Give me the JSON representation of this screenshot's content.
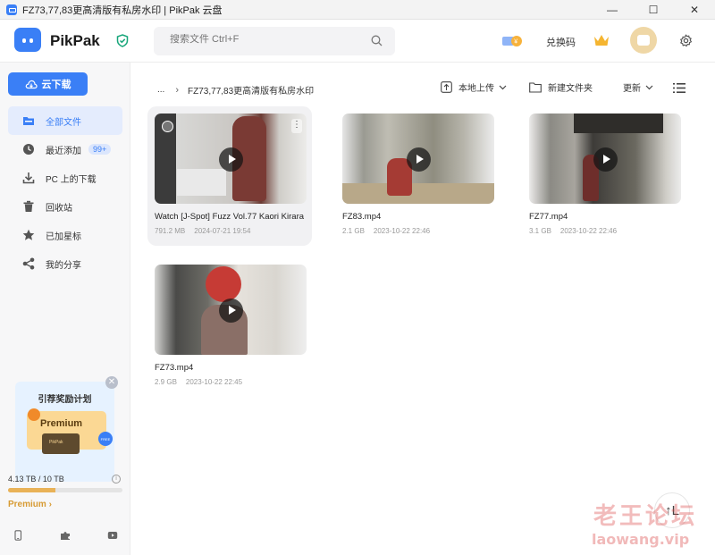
{
  "window": {
    "title": "FZ73,77,83更高清版有私房水印 | PikPak 云盘",
    "controls": [
      "—",
      "☐",
      "✕"
    ]
  },
  "header": {
    "brand": "PikPak",
    "search_placeholder": "搜索文件 Ctrl+F",
    "redeem_label": "兑换码"
  },
  "sidebar": {
    "cloud_download_label": "云下载",
    "items": [
      {
        "label": "全部文件",
        "icon": "folder-icon",
        "active": true
      },
      {
        "label": "最近添加",
        "icon": "clock-icon",
        "badge": "99+"
      },
      {
        "label": "PC 上的下载",
        "icon": "download-icon"
      },
      {
        "label": "回收站",
        "icon": "trash-icon"
      },
      {
        "label": "已加星标",
        "icon": "star-icon"
      },
      {
        "label": "我的分享",
        "icon": "share-icon"
      }
    ],
    "promo": {
      "title": "引荐奖励计划",
      "premium_text": "Premium",
      "free_tag": "FREE"
    },
    "storage": {
      "text": "4.13 TB / 10 TB",
      "used_fraction": 0.413
    },
    "premium_link": "Premium ›"
  },
  "toolbar": {
    "breadcrumb_root": "...",
    "breadcrumb_sep": "›",
    "breadcrumb_current": "FZ73,77,83更高清版有私房水印",
    "upload_label": "本地上传",
    "new_folder_label": "新建文件夹",
    "more_label": "更新"
  },
  "files": [
    {
      "name": "Watch [J-Spot] Fuzz Vol.77 Kaori Kirara",
      "size": "791.2 MB",
      "date": "2024-07-21 19:54"
    },
    {
      "name": "FZ83.mp4",
      "size": "2.1 GB",
      "date": "2023-10-22 22:46"
    },
    {
      "name": "FZ77.mp4",
      "size": "3.1 GB",
      "date": "2023-10-22 22:46"
    },
    {
      "name": "FZ73.mp4",
      "size": "2.9 GB",
      "date": "2023-10-22 22:45"
    }
  ],
  "float_button": "↑L",
  "watermark": {
    "line1": "老王论坛",
    "line2": "laowang.vip"
  },
  "colors": {
    "accent": "#3a7ff6",
    "premium": "#d79b34",
    "watermark": "#dc5050"
  }
}
